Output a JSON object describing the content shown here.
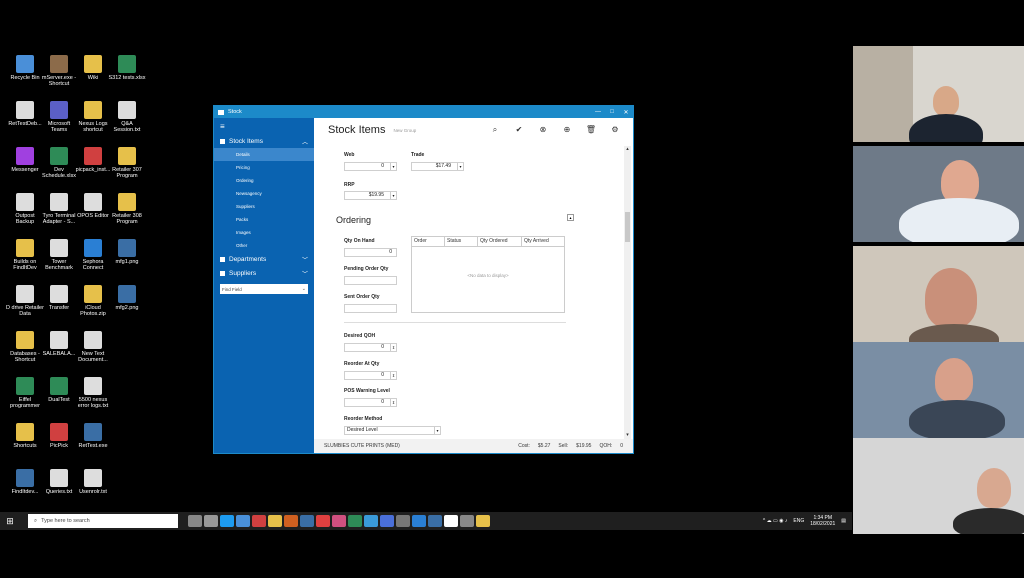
{
  "desktop_icons": [
    {
      "label": "Recycle Bin",
      "color": "#4a8fd8"
    },
    {
      "label": "mServer.exe - Shortcut",
      "color": "#8c6b4a"
    },
    {
      "label": "Wiki",
      "color": "#e6c04a"
    },
    {
      "label": "S312 tests.xlsx",
      "color": "#2e8b57"
    },
    {
      "label": "RetTestDeb...",
      "color": "#dddddd"
    },
    {
      "label": "Microsoft Teams",
      "color": "#5b5fc7"
    },
    {
      "label": "Nexus Logs shortcut",
      "color": "#e6c04a"
    },
    {
      "label": "Q&A Session.txt",
      "color": "#dddddd"
    },
    {
      "label": "Messenger",
      "color": "#a040e0"
    },
    {
      "label": "Dev Schedule.xlsx",
      "color": "#2e8b57"
    },
    {
      "label": "picpack_inst...",
      "color": "#d04040"
    },
    {
      "label": "Retailer 307 Program",
      "color": "#e6c04a"
    },
    {
      "label": "Outpost Backup",
      "color": "#dddddd"
    },
    {
      "label": "Tyro Terminal Adapter - S...",
      "color": "#dddddd"
    },
    {
      "label": "OPOS Editor",
      "color": "#dddddd"
    },
    {
      "label": "Retailer 308 Program",
      "color": "#e6c04a"
    },
    {
      "label": "Builds on FindItDev",
      "color": "#e6c04a"
    },
    {
      "label": "Tower Benchmark",
      "color": "#dddddd"
    },
    {
      "label": "Sephora Connect",
      "color": "#2a7fd4"
    },
    {
      "label": "mfg1.png",
      "color": "#3a6ea5"
    },
    {
      "label": "D drive Retailer Data",
      "color": "#dddddd"
    },
    {
      "label": "Transfer",
      "color": "#dddddd"
    },
    {
      "label": "iCloud Photos.zip",
      "color": "#e6c04a"
    },
    {
      "label": "mfg2.png",
      "color": "#3a6ea5"
    },
    {
      "label": "Databases - Shortcut",
      "color": "#e6c04a"
    },
    {
      "label": "SALEBALA...",
      "color": "#dddddd"
    },
    {
      "label": "New Text Document...",
      "color": "#dddddd"
    },
    {
      "label": "",
      "color": "#000000"
    },
    {
      "label": "Eiffel programmer",
      "color": "#2e8b57"
    },
    {
      "label": "DualTest",
      "color": "#2e8b57"
    },
    {
      "label": "5500 nexus error logs.txt",
      "color": "#dddddd"
    },
    {
      "label": "",
      "color": "#000000"
    },
    {
      "label": "Shortcuts",
      "color": "#e6c04a"
    },
    {
      "label": "PicPick",
      "color": "#d04040"
    },
    {
      "label": "RetTest.exe",
      "color": "#3a6ea5"
    },
    {
      "label": "",
      "color": "#000000"
    },
    {
      "label": "FindItdev...",
      "color": "#3a6ea5"
    },
    {
      "label": "Queries.txt",
      "color": "#dddddd"
    },
    {
      "label": "Usenrolr.txt",
      "color": "#dddddd"
    }
  ],
  "window": {
    "title": "Stock",
    "controls": [
      "—",
      "□",
      "✕"
    ],
    "accent": "#1c8ac9",
    "sidebar_color": "#0a63b1"
  },
  "sidebar": {
    "menu_icon": "hamburger-icon",
    "sections": [
      {
        "label": "Stock Items",
        "items": [
          "Details",
          "Pricing",
          "Ordering",
          "Newsagency",
          "Suppliers",
          "Packs",
          "Images",
          "Other"
        ]
      },
      {
        "label": "Departments",
        "items": []
      },
      {
        "label": "Suppliers",
        "items": []
      }
    ],
    "selected_item": "Details",
    "find_field": "Find Field"
  },
  "header": {
    "title": "Stock Items",
    "subtitle": "New Group",
    "tools": [
      "search-icon",
      "check-icon",
      "cancel-icon",
      "add-icon",
      "delete-icon",
      "gear-icon"
    ]
  },
  "pricing": {
    "web_label": "Web",
    "web_value": "0",
    "trade_label": "Trade",
    "trade_value": "$17.49",
    "rrp_label": "RRP",
    "rrp_value": "$19.95"
  },
  "ordering": {
    "section_title": "Ordering",
    "qty_on_hand_label": "Qty On Hand",
    "qty_on_hand": "0",
    "pending_order_label": "Pending Order Qty",
    "pending_order": "",
    "sent_order_label": "Sent Order Qty",
    "sent_order": "",
    "grid_columns": [
      "Order",
      "Status",
      "Qty Ordered",
      "Qty Arrived"
    ],
    "grid_empty": "<No data to display>",
    "desired_qoh_label": "Desired QOH",
    "desired_qoh": "0",
    "reorder_at_label": "Reorder At Qty",
    "reorder_at": "0",
    "pos_warning_label": "POS Warning Level",
    "pos_warning": "0",
    "reorder_method_label": "Reorder Method",
    "reorder_method": "Desired Level"
  },
  "footer": {
    "item_name": "SLUMBIES CUTE PRINTS (MED)",
    "cost_label": "Cost:",
    "cost": "$5.27",
    "sell_label": "Sell:",
    "sell": "$19.95",
    "qoh_label": "QOH:",
    "qoh": "0"
  },
  "taskbar": {
    "search_placeholder": "Type here to search",
    "app_colors": [
      "#888888",
      "#999999",
      "#1d9bf0",
      "#4a90d9",
      "#d04040",
      "#e6c04a",
      "#d06020",
      "#3a6ea5",
      "#e04040",
      "#d05080",
      "#2e8b57",
      "#3a9ad9",
      "#4a6fd9",
      "#777777",
      "#2a7fd4",
      "#3a6ea5",
      "#ffffff",
      "#888888",
      "#e6c04a"
    ],
    "language": "ENG",
    "time": "1:34 PM",
    "date": "18/02/2021"
  }
}
